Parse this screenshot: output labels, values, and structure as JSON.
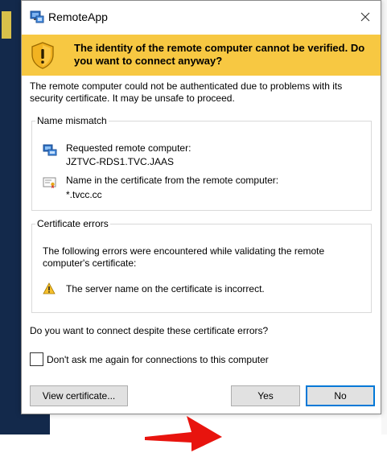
{
  "window": {
    "title": "RemoteApp"
  },
  "banner": {
    "text": "The identity of the remote computer cannot be verified. Do you want to connect anyway?"
  },
  "intro": "The remote computer could not be authenticated due to problems with its security certificate. It may be unsafe to proceed.",
  "name_mismatch": {
    "legend": "Name mismatch",
    "requested_label": "Requested remote computer:",
    "requested_value": "JZTVC-RDS1.TVC.JAAS",
    "cert_label": "Name in the certificate from the remote computer:",
    "cert_value": "*.tvcc.cc"
  },
  "cert_errors": {
    "legend": "Certificate errors",
    "description": "The following errors were encountered while validating the remote computer's certificate:",
    "error": "The server name on the certificate is incorrect."
  },
  "question": "Do you want to connect despite these certificate errors?",
  "dont_ask_checkbox": {
    "label": "Don't ask me again for connections to this computer",
    "checked": false
  },
  "buttons": {
    "view_certificate": "View certificate...",
    "yes": "Yes",
    "no": "No"
  },
  "colors": {
    "banner": "#f7c842",
    "default_button_border": "#0078d7",
    "arrow": "#e8140e"
  },
  "icons": [
    "remoteapp-icon",
    "close-icon",
    "warning-shield-icon",
    "computer-icon",
    "certificate-icon",
    "warning-icon"
  ]
}
